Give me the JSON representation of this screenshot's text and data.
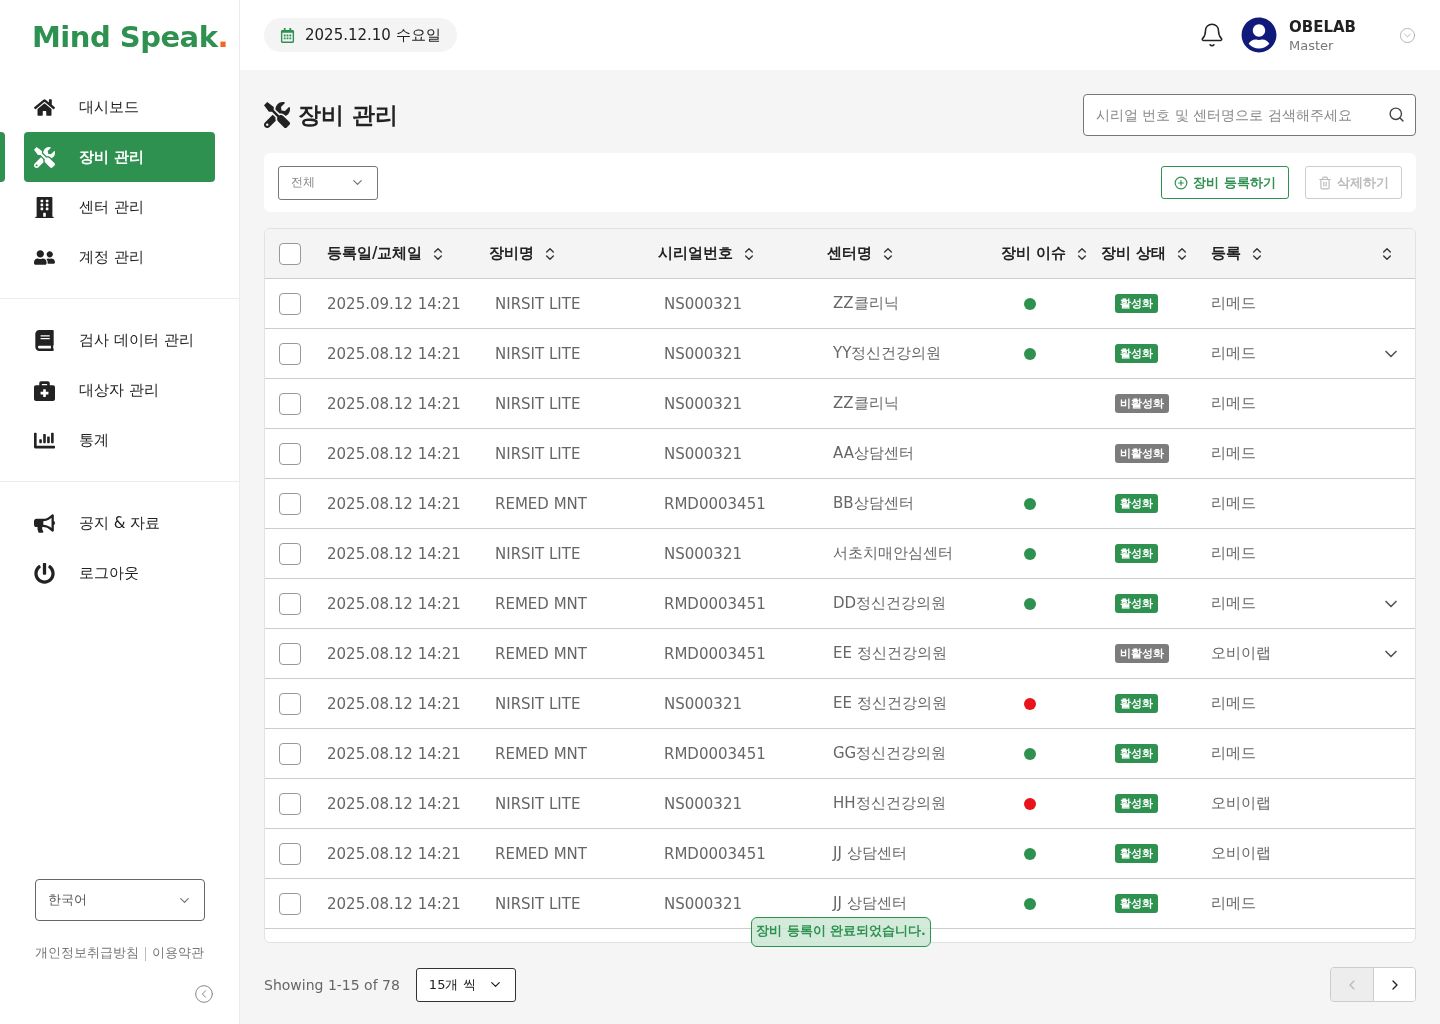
{
  "logo": {
    "text": "Mind Speak",
    "mark": "."
  },
  "sidebar": {
    "sections": [
      [
        {
          "label": "대시보드",
          "selected": false
        },
        {
          "label": "장비 관리",
          "selected": true
        },
        {
          "label": "센터 관리",
          "selected": false
        },
        {
          "label": "계정 관리",
          "selected": false
        }
      ],
      [
        {
          "label": "검사 데이터 관리",
          "selected": false
        },
        {
          "label": "대상자 관리",
          "selected": false
        },
        {
          "label": "통계",
          "selected": false
        }
      ],
      [
        {
          "label": "공지 & 자료",
          "selected": false
        },
        {
          "label": "로그아웃",
          "selected": false
        }
      ]
    ],
    "language": "한국어",
    "links": [
      "개인정보취급방침",
      "이용약관"
    ]
  },
  "header": {
    "date": "2025.12.10 수요일",
    "user": {
      "name": "OBELAB",
      "role": "Master"
    }
  },
  "page": {
    "title": "장비 관리",
    "search": {
      "placeholder": "시리얼 번호 및 센터명으로 검색해주세요"
    }
  },
  "toolbar": {
    "filter": "전체",
    "buttons": [
      {
        "label": "장비 등록하기",
        "disabled": false
      },
      {
        "label": "삭제하기",
        "disabled": true
      }
    ]
  },
  "table": {
    "all_checked": false,
    "columns": [
      "등록일/교체일",
      "장비명",
      "시리얼번호",
      "센터명",
      "장비 이슈",
      "장비 상태",
      "등록"
    ],
    "rows": [
      {
        "date": "2025.09.12 14:21",
        "device": "NIRSIT LITE",
        "serial": "NS000321",
        "center": "ZZ클리닉",
        "color": "#2e9150",
        "status": {
          "label": "활성화",
          "active": true
        },
        "registrar": "리메드",
        "checked": false,
        "expandable": false
      },
      {
        "date": "2025.08.12 14:21",
        "device": "NIRSIT LITE",
        "serial": "NS000321",
        "center": "YY정신건강의원",
        "color": "#2e9150",
        "status": {
          "label": "활성화",
          "active": true
        },
        "registrar": "리메드",
        "checked": false,
        "expandable": true
      },
      {
        "date": "2025.08.12 14:21",
        "device": "NIRSIT LITE",
        "serial": "NS000321",
        "center": "ZZ클리닉",
        "status": {
          "label": "비활성화",
          "active": false
        },
        "registrar": "리메드",
        "checked": false,
        "expandable": false
      },
      {
        "date": "2025.08.12 14:21",
        "device": "NIRSIT LITE",
        "serial": "NS000321",
        "center": "AA상담센터",
        "status": {
          "label": "비활성화",
          "active": false
        },
        "registrar": "리메드",
        "checked": false,
        "expandable": false
      },
      {
        "date": "2025.08.12 14:21",
        "device": "REMED MNT",
        "serial": "RMD0003451",
        "center": "BB상담센터",
        "color": "#2e9150",
        "status": {
          "label": "활성화",
          "active": true
        },
        "registrar": "리메드",
        "checked": false,
        "expandable": false
      },
      {
        "date": "2025.08.12 14:21",
        "device": "NIRSIT LITE",
        "serial": "NS000321",
        "center": "서초치매안심센터",
        "color": "#2e9150",
        "status": {
          "label": "활성화",
          "active": true
        },
        "registrar": "리메드",
        "checked": false,
        "expandable": false
      },
      {
        "date": "2025.08.12 14:21",
        "device": "REMED MNT",
        "serial": "RMD0003451",
        "center": "DD정신건강의원",
        "color": "#2e9150",
        "status": {
          "label": "활성화",
          "active": true
        },
        "registrar": "리메드",
        "checked": false,
        "expandable": true
      },
      {
        "date": "2025.08.12 14:21",
        "device": "REMED MNT",
        "serial": "RMD0003451",
        "center": "EE 정신건강의원",
        "status": {
          "label": "비활성화",
          "active": false
        },
        "registrar": "오비이랩",
        "checked": false,
        "expandable": true
      },
      {
        "date": "2025.08.12 14:21",
        "device": "NIRSIT LITE",
        "serial": "NS000321",
        "center": "EE 정신건강의원",
        "color": "#e8141b",
        "status": {
          "label": "활성화",
          "active": true
        },
        "registrar": "리메드",
        "checked": false,
        "expandable": false
      },
      {
        "date": "2025.08.12 14:21",
        "device": "REMED MNT",
        "serial": "RMD0003451",
        "center": "GG정신건강의원",
        "color": "#2e9150",
        "status": {
          "label": "활성화",
          "active": true
        },
        "registrar": "리메드",
        "checked": false,
        "expandable": false
      },
      {
        "date": "2025.08.12 14:21",
        "device": "NIRSIT LITE",
        "serial": "NS000321",
        "center": "HH정신건강의원",
        "color": "#e8141b",
        "status": {
          "label": "활성화",
          "active": true
        },
        "registrar": "오비이랩",
        "checked": false,
        "expandable": false
      },
      {
        "date": "2025.08.12 14:21",
        "device": "REMED MNT",
        "serial": "RMD0003451",
        "center": "JJ 상담센터",
        "color": "#2e9150",
        "status": {
          "label": "활성화",
          "active": true
        },
        "registrar": "오비이랩",
        "checked": false,
        "expandable": false
      },
      {
        "date": "2025.08.12 14:21",
        "device": "NIRSIT LITE",
        "serial": "NS000321",
        "center": "JJ 상담센터",
        "color": "#2e9150",
        "status": {
          "label": "활성화",
          "active": true
        },
        "registrar": "리메드",
        "checked": false,
        "expandable": false
      }
    ]
  },
  "toast": "장비 등록이 완료되었습니다.",
  "pagination": {
    "summary": "Showing 1-15 of 78",
    "page_size": "15개 씩",
    "prev_disabled": true,
    "next_disabled": false
  }
}
